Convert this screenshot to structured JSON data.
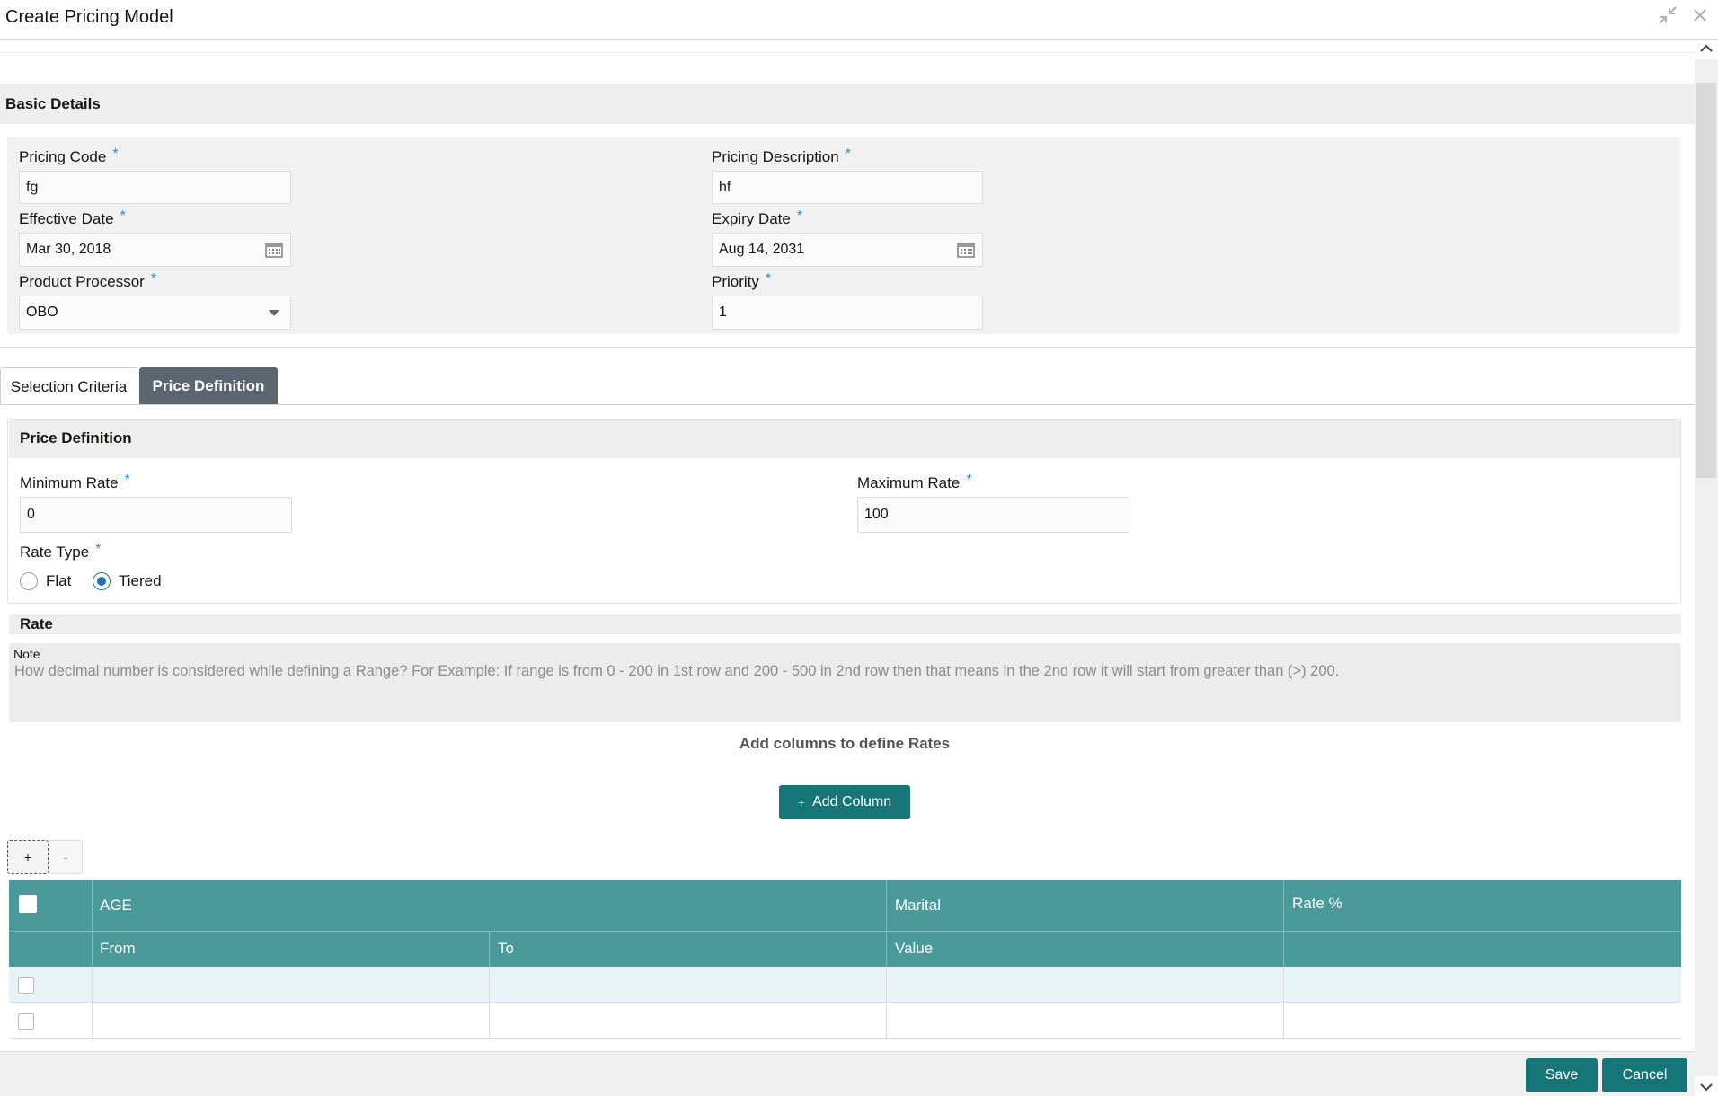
{
  "window": {
    "title": "Create Pricing Model",
    "icons": [
      "minimize-icon",
      "close-icon"
    ]
  },
  "basic_details": {
    "heading": "Basic Details",
    "pricing_code_label": "Pricing Code",
    "pricing_code_value": "fg",
    "pricing_description_label": "Pricing Description",
    "pricing_description_value": "hf",
    "effective_date_label": "Effective Date",
    "effective_date_value": "Mar 30, 2018",
    "expiry_date_label": "Expiry Date",
    "expiry_date_value": "Aug 14, 2031",
    "product_processor_label": "Product Processor",
    "product_processor_value": "OBO",
    "priority_label": "Priority",
    "priority_value": "1",
    "required_marker": "*"
  },
  "tabs": [
    {
      "label": "Selection Criteria",
      "active": false
    },
    {
      "label": "Price Definition",
      "active": true
    }
  ],
  "price_definition": {
    "heading": "Price Definition",
    "minimum_rate_label": "Minimum Rate",
    "minimum_rate_value": "0",
    "maximum_rate_label": "Maximum Rate",
    "maximum_rate_value": "100",
    "rate_type_label": "Rate Type",
    "rate_type_options": [
      "Flat",
      "Tiered"
    ],
    "rate_type_selected": "Tiered"
  },
  "rate": {
    "heading": "Rate",
    "note_title": "Note",
    "note_text": "How decimal number is considered while defining a Range? For Example: If range is from 0 - 200 in 1st row and 200 - 500 in 2nd row then that means in the 2nd row it will start from greater than (>) 200.",
    "add_columns_title": "Add columns to define Rates",
    "add_column_button": "Add Column",
    "add_column_plus": "+",
    "add_row_button": "+",
    "remove_row_button": "-"
  },
  "table": {
    "group_headers": [
      "AGE",
      "Marital",
      "Rate %"
    ],
    "sub_headers": [
      "From",
      "To",
      "Value"
    ],
    "rows": [
      {
        "from": "",
        "to": "",
        "value": "",
        "rate": ""
      },
      {
        "from": "",
        "to": "",
        "value": "",
        "rate": ""
      }
    ]
  },
  "footer": {
    "save_label": "Save",
    "cancel_label": "Cancel"
  },
  "colors": {
    "accent": "#167577",
    "table_header": "#4a9a9c",
    "active_tab": "#5c6670",
    "required": "#2e8ecf",
    "radio_selected": "#2272b4"
  }
}
